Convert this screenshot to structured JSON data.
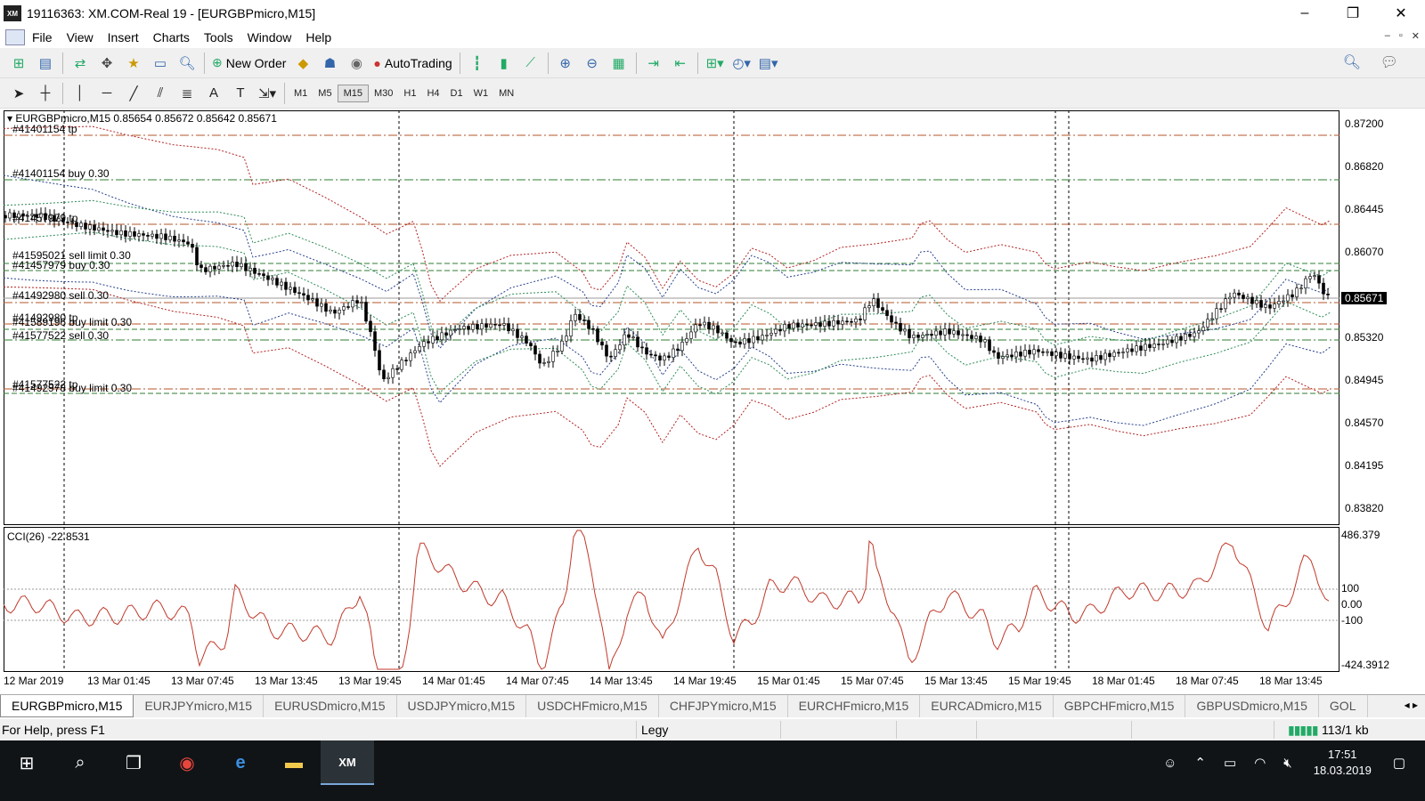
{
  "window": {
    "logo_text": "XM",
    "title": "19116363: XM.COM-Real 19 - [EURGBPmicro,M15]",
    "minimize": "–",
    "maximize": "❐",
    "close": "✕"
  },
  "menu": {
    "items": [
      "File",
      "View",
      "Insert",
      "Charts",
      "Tools",
      "Window",
      "Help"
    ],
    "doc_controls": [
      "–",
      "▫",
      "✕"
    ]
  },
  "toolbar": {
    "new_order": "New Order",
    "autotrading": "AutoTrading",
    "timeframes": [
      "M1",
      "M5",
      "M15",
      "M30",
      "H1",
      "H4",
      "D1",
      "W1",
      "MN"
    ],
    "active_timeframe": "M15",
    "text_tool": "A",
    "textlabel_tool": "T"
  },
  "chart": {
    "header": "EURGBPmicro,M15  0.85654 0.85672 0.85642 0.85671",
    "current_price": "0.85671",
    "price_ticks": [
      "0.87200",
      "0.86820",
      "0.86445",
      "0.86070",
      "0.85320",
      "0.84945",
      "0.84570",
      "0.84195",
      "0.83820"
    ],
    "orders": [
      "#41401154 tp",
      "#41401154 buy 0.30",
      "#41457979 tp",
      "#41595021 sell limit 0.30",
      "#41457979 buy 0.30",
      "#41492980 sell 0.30",
      "#41492980 tp",
      "#41589196 buy limit 0.30",
      "#41577522 sell 0.30",
      "#41577522 tp",
      "#41492978 buy limit 0.30"
    ],
    "cci_header": "CCI(26) -22.8531",
    "cci_ticks": [
      "486.379",
      "100",
      "0.00",
      "-100",
      "-424.3912"
    ],
    "time_labels": [
      "12 Mar 2019",
      "13 Mar 01:45",
      "13 Mar 07:45",
      "13 Mar 13:45",
      "13 Mar 19:45",
      "14 Mar 01:45",
      "14 Mar 07:45",
      "14 Mar 13:45",
      "14 Mar 19:45",
      "15 Mar 01:45",
      "15 Mar 07:45",
      "15 Mar 13:45",
      "15 Mar 19:45",
      "18 Mar 01:45",
      "18 Mar 07:45",
      "18 Mar 13:45"
    ]
  },
  "tabs": {
    "items": [
      "EURGBPmicro,M15",
      "EURJPYmicro,M15",
      "EURUSDmicro,M15",
      "USDJPYmicro,M15",
      "USDCHFmicro,M15",
      "CHFJPYmicro,M15",
      "EURCHFmicro,M15",
      "EURCADmicro,M15",
      "GBPCHFmicro,M15",
      "GBPUSDmicro,M15",
      "GOL"
    ],
    "nav": "◂ ▸"
  },
  "status": {
    "help": "For Help, press F1",
    "profile": "Legy",
    "traffic": "113/1 kb"
  },
  "taskbar": {
    "time": "17:51",
    "date": "18.03.2019",
    "app_label": "XM"
  }
}
